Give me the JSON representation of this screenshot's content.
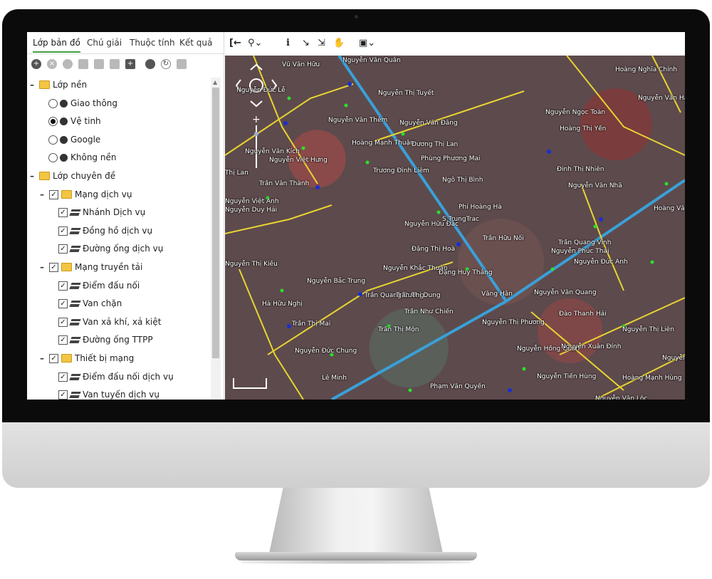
{
  "tabs": [
    "Lớp bản đồ",
    "Chú giải",
    "Thuộc tính",
    "Kết quả"
  ],
  "tree": {
    "base_group": "Lớp nền",
    "base_items": [
      {
        "label": "Giao thông",
        "selected": false
      },
      {
        "label": "Vệ tinh",
        "selected": true
      },
      {
        "label": "Google",
        "selected": false
      },
      {
        "label": "Không nền",
        "selected": false
      }
    ],
    "thematic_group": "Lớp chuyên đề",
    "groups": [
      {
        "label": "Mạng dịch vụ",
        "items": [
          "Nhánh Dịch vụ",
          "Đồng hồ dịch vụ",
          "Đường ống dịch vụ"
        ]
      },
      {
        "label": "Mạng truyền tải",
        "items": [
          "Điểm đấu nối",
          "Van chặn",
          "Van xả khí, xả kiệt",
          "Đường ống TTPP"
        ]
      },
      {
        "label": "Thiết bị mạng",
        "items": [
          "Điểm đấu nối dịch vụ",
          "Van tuyến dịch vụ"
        ]
      }
    ]
  },
  "map_labels": [
    "Vũ Văn Hữu",
    "Nguyễn Văn Quân",
    "Hoàng Nghĩa Chính",
    "Nguyễn Đức Lễ",
    "Nguyễn Thị Tuyết",
    "Nguyễn Văn Hải",
    "Nguyễn Ngọc Toàn",
    "Nguyễn Văn Thêm",
    "Nguyễn Văn Đăng",
    "Hoàng Thị Yến",
    "Hoàng Mạnh Thuận",
    "Dương Thị Lan",
    "Nguyễn Văn Kích",
    "Nguyễn Việt Hưng",
    "Phùng Phương Mai",
    "Đinh Thị Nhiên",
    "Thị Lan",
    "Trương Đình Liêm",
    "Trần Văn Thành",
    "Ngô Thị Bình",
    "Nguyễn Văn Nhã",
    "Nguyễn Việt Anh",
    "Nguyễn Duy Hải",
    "Phí Hoàng Hà",
    "S.TrungTrac",
    "Hoàng Văn",
    "Nguyễn Hữu Đắc",
    "Trần Hữu Nối",
    "Trần Quang Vinh",
    "Nguyễn Phúc Thái",
    "Đặng Thị Hoà",
    "Nguyễn Thị Kiều",
    "Nguyễn Khắc Thuận",
    "Nguyễn Đức Anh",
    "Đặng Huy Thắng",
    "Nguyễn Bắc Trung",
    "Trần Quang Cương",
    "Trần Thị Dung",
    "Văng Hân",
    "Nguyễn Văn Quang",
    "Hà Hữu Nghị",
    "Trần Như Chiến",
    "Đào Thanh Hải",
    "Trần Thị Mai",
    "Nguyễn Thị Phương",
    "Nguyễn Thị Liên",
    "Trần Thị Mộn",
    "Nguyễn Hồng Quân",
    "Nguyễn Xuân Đính",
    "Nguyễn Đức Chung",
    "Nguyễn Hườn",
    "Lê Minh",
    "Nguyễn Tiến Hùng",
    "Hoàng Mạnh Hùng",
    "Phạm Văn Quyền",
    "Nguyễn Văn Lộc"
  ]
}
